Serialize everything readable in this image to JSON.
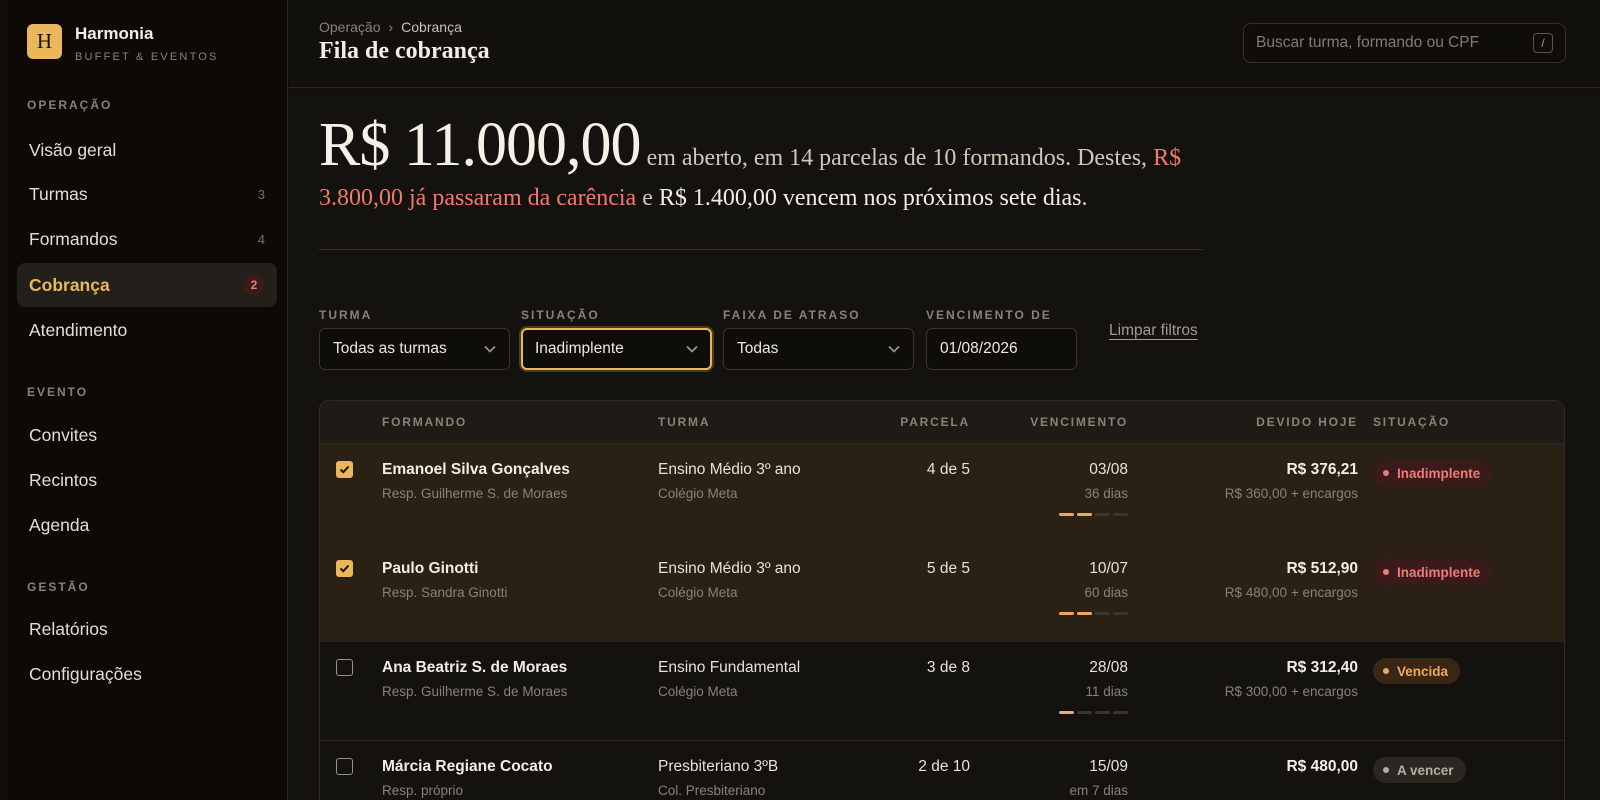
{
  "brand": {
    "logo_letter": "H",
    "name": "Harmonia",
    "subtitle": "BUFFET & EVENTOS"
  },
  "sidebar": {
    "sections": [
      {
        "title": "OPERAÇÃO",
        "items": [
          {
            "label": "Visão geral",
            "count": ""
          },
          {
            "label": "Turmas",
            "count": "3"
          },
          {
            "label": "Formandos",
            "count": "4"
          },
          {
            "label": "Cobrança",
            "count": "2",
            "active": true
          },
          {
            "label": "Atendimento",
            "count": ""
          }
        ]
      },
      {
        "title": "EVENTO",
        "items": [
          {
            "label": "Convites"
          },
          {
            "label": "Recintos"
          },
          {
            "label": "Agenda"
          }
        ]
      },
      {
        "title": "GESTÃO",
        "items": [
          {
            "label": "Relatórios"
          },
          {
            "label": "Configurações"
          }
        ]
      }
    ]
  },
  "header": {
    "breadcrumb": [
      "Operação",
      "Cobrança"
    ],
    "breadcrumb_separator": "›",
    "title": "Fila de cobrança",
    "search_placeholder": "Buscar turma, formando ou CPF",
    "search_shortcut": "/"
  },
  "summary": {
    "amount": "R$ 11.000,00",
    "text_1": " em aberto, em 14 parcelas de 10 formandos. Destes, ",
    "overdue": "R$ 3.800,00 já passaram da carência",
    "text_2": " e ",
    "upcoming": "R$ 1.400,00 vencem nos próximos sete dias",
    "text_3": "."
  },
  "filters": {
    "turma": {
      "label": "TURMA",
      "value": "Todas as turmas"
    },
    "situacao": {
      "label": "SITUAÇÃO",
      "value": "Inadimplente"
    },
    "faixa": {
      "label": "FAIXA DE ATRASO",
      "value": "Todas"
    },
    "vencimento": {
      "label": "VENCIMENTO DE",
      "value": "01/08/2026"
    },
    "clear_label": "Limpar filtros"
  },
  "table": {
    "headers": {
      "formando": "FORMANDO",
      "turma": "TURMA",
      "parcela": "PARCELA",
      "vencimento": "VENCIMENTO",
      "devido": "DEVIDO HOJE",
      "situacao": "SITUAÇÃO"
    },
    "rows": [
      {
        "selected": true,
        "name": "Emanoel Silva Gonçalves",
        "resp": "Resp. Guilherme S. de Moraes",
        "turma": "Ensino Médio 3º ano",
        "escola": "Colégio Meta",
        "parcela": "4 de 5",
        "venc": "03/08",
        "venc_sub": "36 dias",
        "delay_level": 2,
        "devido": "R$ 376,21",
        "devido_sub": "R$ 360,00 + encargos",
        "status": "Inadimplente",
        "status_kind": "inad"
      },
      {
        "selected": true,
        "name": "Paulo Ginotti",
        "resp": "Resp. Sandra Ginotti",
        "turma": "Ensino Médio 3º ano",
        "escola": "Colégio Meta",
        "parcela": "5 de 5",
        "venc": "10/07",
        "venc_sub": "60 dias",
        "delay_level": 2,
        "devido": "R$ 512,90",
        "devido_sub": "R$ 480,00 + encargos",
        "status": "Inadimplente",
        "status_kind": "inad"
      },
      {
        "selected": false,
        "name": "Ana Beatriz S. de Moraes",
        "resp": "Resp. Guilherme S. de Moraes",
        "turma": "Ensino Fundamental",
        "escola": "Colégio Meta",
        "parcela": "3 de 8",
        "venc": "28/08",
        "venc_sub": "11 dias",
        "delay_level": 1,
        "devido": "R$ 312,40",
        "devido_sub": "R$ 300,00 + encargos",
        "status": "Vencida",
        "status_kind": "venc"
      },
      {
        "selected": false,
        "name": "Márcia Regiane Cocato",
        "resp": "Resp. próprio",
        "turma": "Presbiteriano 3ºB",
        "escola": "Col. Presbiteriano",
        "parcela": "2 de 10",
        "venc": "15/09",
        "venc_sub": "em 7 dias",
        "delay_level": 0,
        "devido": "R$ 480,00",
        "devido_sub": "",
        "status": "A vencer",
        "status_kind": "aven"
      }
    ]
  },
  "colors": {
    "accent": "#eab85a",
    "danger": "#f07a6c",
    "warning": "#f0a860"
  }
}
